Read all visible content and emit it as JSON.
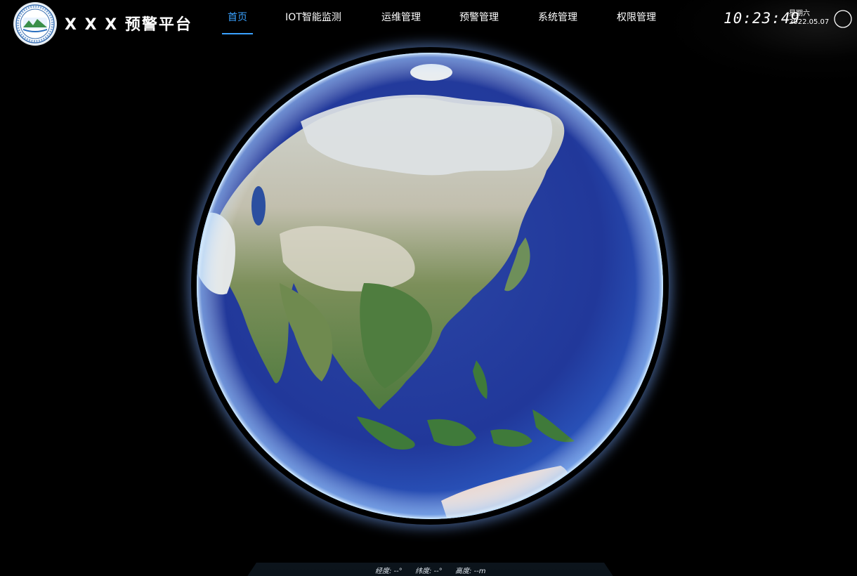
{
  "app": {
    "title": "X X X 预警平台",
    "logo_icon": "organization-seal-logo"
  },
  "nav": {
    "items": [
      {
        "label": "首页",
        "active": true
      },
      {
        "label": "IOT智能监测",
        "active": false
      },
      {
        "label": "运维管理",
        "active": false
      },
      {
        "label": "预警管理",
        "active": false
      },
      {
        "label": "系统管理",
        "active": false
      },
      {
        "label": "权限管理",
        "active": false
      }
    ],
    "active_color": "#3aa2ff"
  },
  "clock": {
    "time": "10:23:49",
    "weekday": "星期六",
    "date": "2022.05.07"
  },
  "user": {
    "icon": "user-avatar-icon"
  },
  "status": {
    "longitude": "经度: --°",
    "latitude": "纬度: --°",
    "altitude": "高度: --m"
  },
  "globe": {
    "ocean_color": "#21389a",
    "land_color": "#5f7f4a",
    "snow_color": "#dfe3e6"
  }
}
